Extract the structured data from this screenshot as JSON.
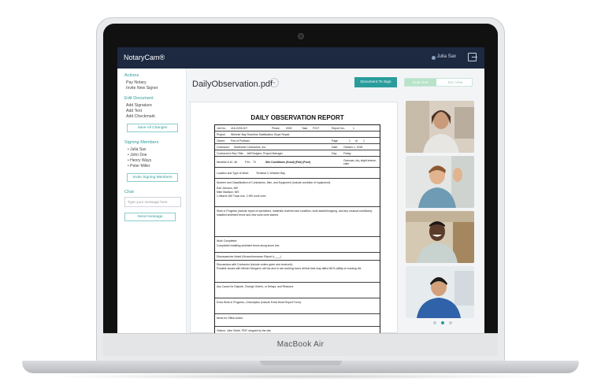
{
  "device": {
    "label": "MacBook Air"
  },
  "app": {
    "brand": "NotaryCam®",
    "user_name": "Julia Sax",
    "colors": {
      "topbar": "#1c2940",
      "accent": "#2a9c9c"
    }
  },
  "sidebar": {
    "actions_title": "Actions",
    "actions": [
      "Pay Notary",
      "Invite New Signer"
    ],
    "edit_title": "Edit Document",
    "edit_items": [
      "Add Signature",
      "Add Text",
      "Add Checkmark"
    ],
    "all_changes_button": "Save All Changes",
    "members_title": "Signing Members",
    "members": [
      "Julia Sax",
      "John Doe",
      "Henry Ways",
      "Peter Miller"
    ],
    "invite_button": "Invite Signing Members",
    "chat_title": "Chat",
    "chat_placeholder": "Type your message here",
    "send_button": "Send message"
  },
  "main": {
    "doc_name": "DailyObservation.pdf",
    "action_button": "Document To Sign",
    "toggle_left": "Dual View",
    "toggle_right": "Doc View"
  },
  "report": {
    "title": "DAILY OBSERVATION REPORT",
    "job_no_label": "Job No.:",
    "job_no": "416-2228-007",
    "phase_label": "Phase:",
    "phase": "0000",
    "task_label": "Task:",
    "task": "FC07",
    "report_no_label": "Report No.:",
    "report_no": "1",
    "project_label": "Project:",
    "project": "Wheeler Bay Shoreline Stabilization Slope Repair",
    "owner_label": "Owner:",
    "owner": "Port of Portland",
    "page_label": "Page",
    "page_no": "1",
    "page_of": "of",
    "page_total": "1",
    "contractor_label": "Contractor:",
    "contractor": "Northwest Contractors, Inc.",
    "date_label": "Date:",
    "date": "October 1, 2018",
    "rep_label": "Contractor's Rep./Title:",
    "rep": "Jeff Rodgers, Project Manager",
    "day_label": "Day:",
    "day": "Friday",
    "weather_label": "Weather A.M.:",
    "weather_am": "48",
    "weather_pm_label": "P.M.:",
    "weather_pm": "70",
    "site_label": "Site Conditions (Good) (Fair) (Poor)",
    "conditions": "Overcast, dry, slight breeze, calm",
    "location_label": "Location and Type of Work:",
    "location": "Terminal 4, Wheeler Bay",
    "personnel_label": "Number and Classification of Contractors, Men, and Equipment (include condition of equipment):",
    "personnel": [
      "Earl Johnson, NEI",
      "Mike Madison, NEI",
      "1-Hitachi 160 Track hoe, 2-HEI work crew"
    ],
    "progress_label": "Work in Progress (include report of operations, materials received and condition, work started/ongoing, and any unusual conditions):",
    "progress": "Installed sediment fence and new work were started.",
    "completed_label": "Work Completed:",
    "completed": "Completed installing sediment fence along shore line.",
    "deficiency_label": "Discrepancies Noted (Nonconformance Report #____)",
    "discussion_label": "Discussions with Contractor (include orders given and received):",
    "discussion": "Possible issues with Winder Morgan's rail line and in use working hours all that time may affect NEI's ability of crossing the",
    "delays_label": "Any Cause for Dispute, Change Orders, or Delays, and Reasons:",
    "extra_label": "Extra Work in Progress—Description (include Extra Work Report Form):",
    "office_label": "Items for Office Action:",
    "visitors_label": "Visitors: John Smith, PDP, stopped by the site."
  },
  "videos": {
    "participants": [
      "Julia Sax",
      "John Doe",
      "Henry Ways",
      "Peter Miller"
    ],
    "active_page": 2,
    "page_count": 3
  }
}
